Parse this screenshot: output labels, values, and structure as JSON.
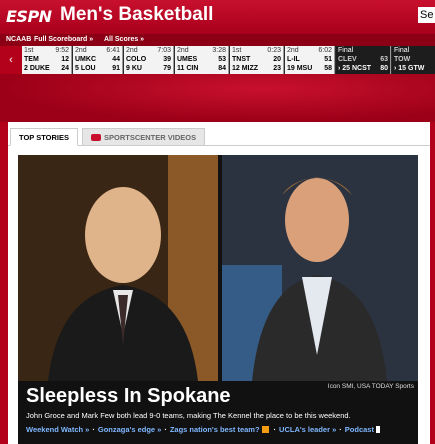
{
  "header": {
    "logo": "ESPN",
    "title": "Men's Basketball",
    "search_placeholder": "Se"
  },
  "scoreboard": {
    "league": "NCAAB",
    "full_scoreboard": "Full Scoreboard »",
    "all_scores": "All Scores »",
    "games": [
      {
        "period": "1st",
        "clock": "9:52",
        "t1": "TEM",
        "s1": "12",
        "t2": "2 DUKE",
        "s2": "24",
        "final": false
      },
      {
        "period": "2nd",
        "clock": "6:41",
        "t1": "UMKC",
        "s1": "44",
        "t2": "5 LOU",
        "s2": "91",
        "final": false
      },
      {
        "period": "2nd",
        "clock": "7:03",
        "t1": "COLO",
        "s1": "39",
        "t2": "9 KU",
        "s2": "79",
        "final": false
      },
      {
        "period": "2nd",
        "clock": "3:28",
        "t1": "UMES",
        "s1": "53",
        "t2": "11 CIN",
        "s2": "84",
        "final": false
      },
      {
        "period": "1st",
        "clock": "0:23",
        "t1": "TNST",
        "s1": "20",
        "t2": "12 MIZZ",
        "s2": "23",
        "final": false
      },
      {
        "period": "2nd",
        "clock": "6:02",
        "t1": "L-IL",
        "s1": "51",
        "t2": "19 MSU",
        "s2": "58",
        "final": false
      },
      {
        "period": "Final",
        "clock": "",
        "t1": "CLEV",
        "s1": "63",
        "t2": "› 25 NCST",
        "s2": "80",
        "final": true
      },
      {
        "period": "Final",
        "clock": "",
        "t1": "TOW",
        "s1": "",
        "t2": "› 15 GTW",
        "s2": "",
        "final": true
      }
    ]
  },
  "tabs": {
    "top_stories": "TOP STORIES",
    "sportscenter_videos": "SPORTSCENTER VIDEOS"
  },
  "story": {
    "credit": "Icon SMI, USA TODAY Sports",
    "headline": "Sleepless In Spokane",
    "blurb": "John Groce and Mark Few both lead 9-0 teams, making The Kennel the place to be this weekend.",
    "links": [
      "Weekend Watch »",
      "Gonzaga's edge »",
      "Zags nation's best team?",
      "UCLA's leader »",
      "Podcast"
    ]
  }
}
